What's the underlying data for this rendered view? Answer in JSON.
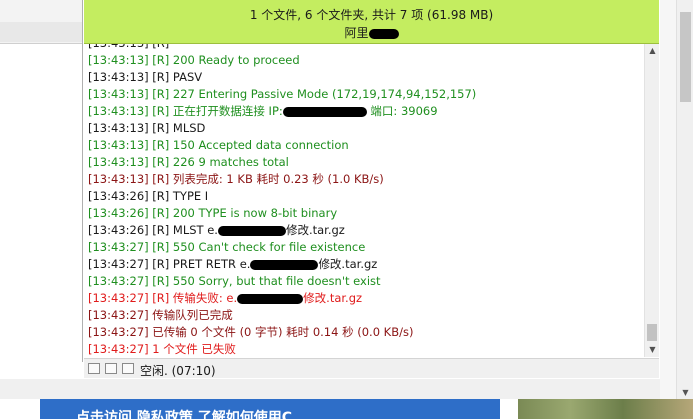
{
  "header": {
    "summary": "1 个文件, 6 个文件夹, 共计 7 项 (61.98 MB)",
    "owner": "阿里"
  },
  "log": {
    "partial_top": "[13:43:13] [R]",
    "entries": [
      {
        "ts": "[13:43:13]",
        "pre": "[R] 200 Ready to proceed",
        "post": "",
        "color": "green"
      },
      {
        "ts": "[13:43:13]",
        "pre": "[R] PASV",
        "post": "",
        "color": "black"
      },
      {
        "ts": "[13:43:13]",
        "pre": "[R] 227 Entering Passive Mode (172,19,174,94,152,157)",
        "post": "",
        "color": "green"
      },
      {
        "ts": "[13:43:13]",
        "pre": "[R] 正在打开数据连接 IP:",
        "post": " 端口: 39069",
        "color": "green",
        "redact": 84
      },
      {
        "ts": "[13:43:13]",
        "pre": "[R] MLSD",
        "post": "",
        "color": "black"
      },
      {
        "ts": "[13:43:13]",
        "pre": "[R] 150 Accepted data connection",
        "post": "",
        "color": "green"
      },
      {
        "ts": "[13:43:13]",
        "pre": "[R] 226 9 matches total",
        "post": "",
        "color": "green"
      },
      {
        "ts": "[13:43:13]",
        "pre": "[R] 列表完成: 1 KB 耗时 0.23 秒 (1.0 KB/s)",
        "post": "",
        "color": "darkred"
      },
      {
        "ts": "[13:43:26]",
        "pre": "[R] TYPE I",
        "post": "",
        "color": "black"
      },
      {
        "ts": "[13:43:26]",
        "pre": "[R] 200 TYPE is now 8-bit binary",
        "post": "",
        "color": "green"
      },
      {
        "ts": "[13:43:26]",
        "pre": "[R] MLST e.",
        "post": "修改.tar.gz",
        "color": "black",
        "redact": 68
      },
      {
        "ts": "[13:43:27]",
        "pre": "[R] 550 Can't check for file existence",
        "post": "",
        "color": "green"
      },
      {
        "ts": "[13:43:27]",
        "pre": "[R] PRET RETR e.",
        "post": "修改.tar.gz",
        "color": "black",
        "redact": 68
      },
      {
        "ts": "[13:43:27]",
        "pre": "[R] 550 Sorry, but that file doesn't exist",
        "post": "",
        "color": "green"
      },
      {
        "ts": "[13:43:27]",
        "pre": "[R] 传输失败: e.",
        "post": "修改.tar.gz",
        "color": "red",
        "redact": 66
      },
      {
        "ts": "[13:43:27]",
        "pre": "传输队列已完成",
        "post": "",
        "color": "darkred"
      },
      {
        "ts": "[13:43:27]",
        "pre": "已传输 0 个文件 (0 字节) 耗时 0.14 秒 (0.0 KB/s)",
        "post": "",
        "color": "darkred"
      },
      {
        "ts": "[13:43:27]",
        "pre": "1 个文件 已失败",
        "post": "",
        "color": "red"
      }
    ]
  },
  "statusbar": {
    "text": "空闲. (07:10)"
  },
  "banner": {
    "text": "点击访问 隐私政策 了解如何使用C... ",
    "accent": "#2e6ec8"
  },
  "colors": {
    "header_bg": "#c4ed60",
    "green": "#1f8f1f",
    "darkred": "#8b1414",
    "red": "#e01b1b"
  }
}
